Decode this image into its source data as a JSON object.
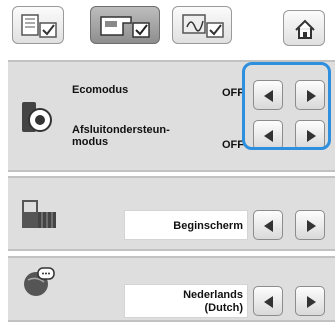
{
  "topbar": {
    "tabs": [
      {
        "icon": "book-checkbox-icon",
        "selected": false
      },
      {
        "icon": "machine-checkbox-icon",
        "selected": true
      },
      {
        "icon": "embroidery-checkbox-icon",
        "selected": false
      }
    ],
    "home_icon": "home-icon"
  },
  "settings": {
    "eco_mode": {
      "label": "Ecomodus",
      "value": "OFF"
    },
    "shutoff_support": {
      "label_line1": "Afsluitondersteun-",
      "label_line2": "modus",
      "value": "OFF"
    },
    "start_screen": {
      "value": "Beginscherm"
    },
    "language": {
      "value_line1": "Nederlands",
      "value_line2": "(Dutch)"
    }
  },
  "icons": {
    "eco": "eco-mode-icon",
    "screen": "start-screen-icon",
    "globe": "language-globe-icon",
    "left": "left-arrow-icon",
    "right": "right-arrow-icon"
  },
  "colors": {
    "highlight": "#2f8fdf",
    "panel": "#dedede"
  }
}
